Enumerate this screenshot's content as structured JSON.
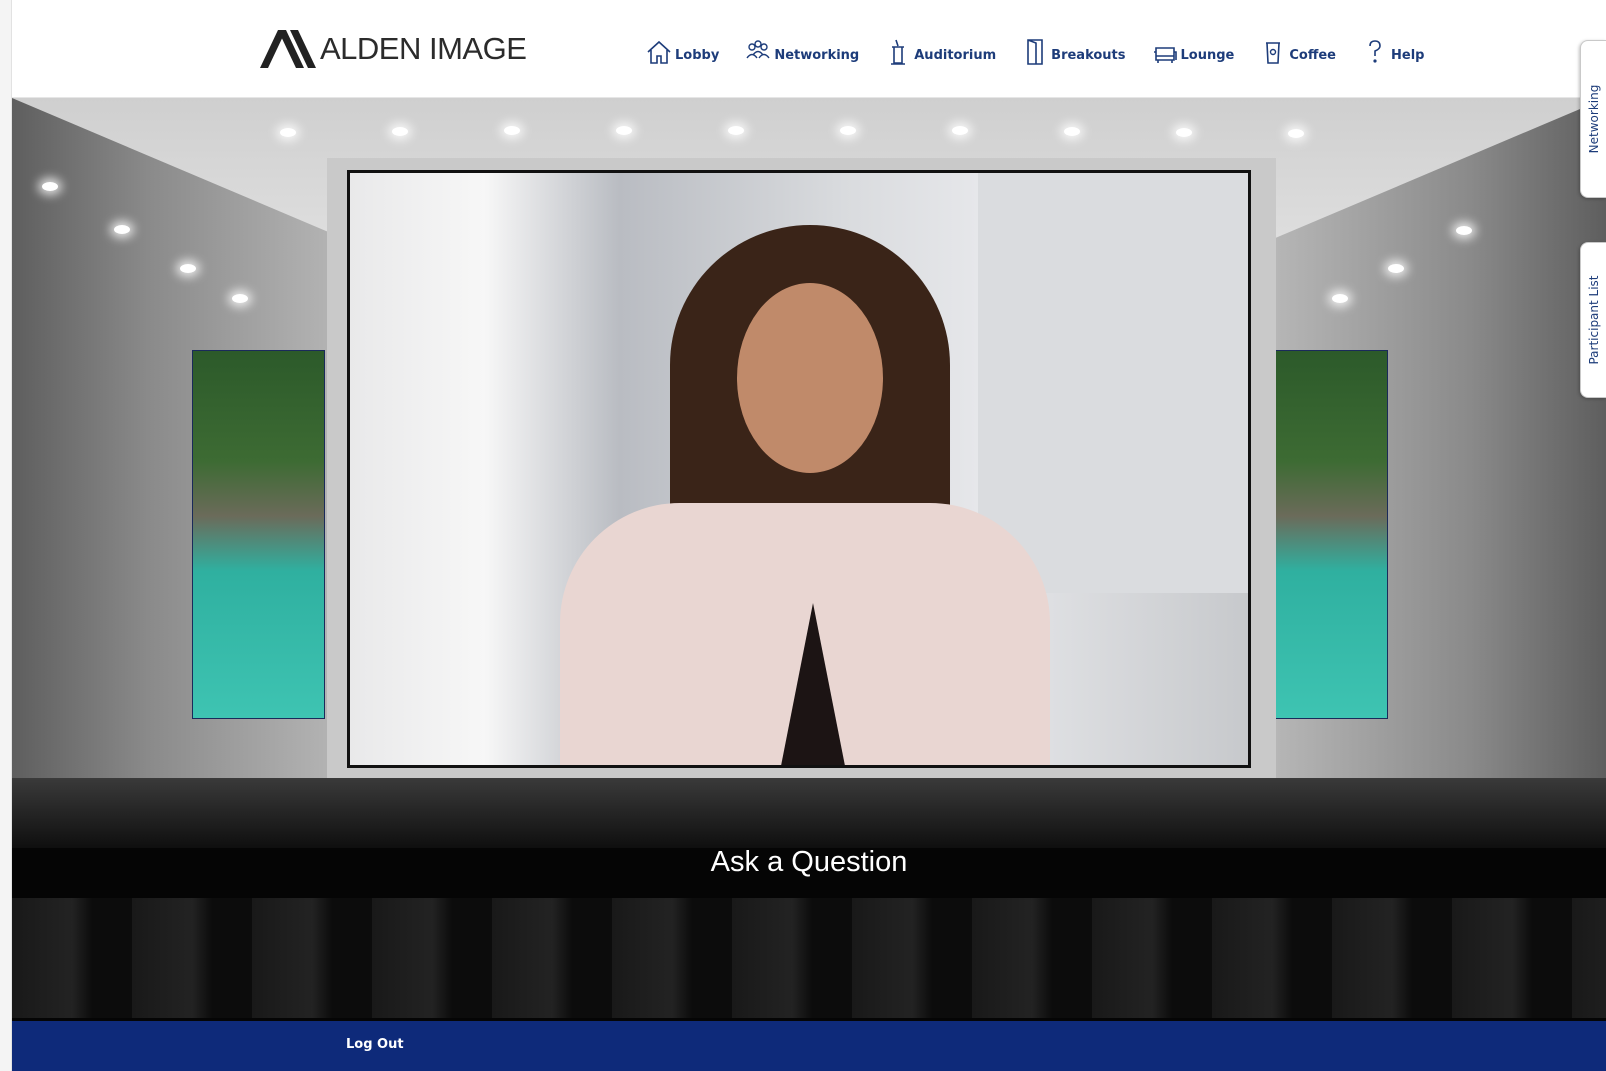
{
  "header": {
    "logo_text": "ALDEN IMAGE",
    "nav": [
      {
        "label": "Lobby",
        "icon": "home-icon"
      },
      {
        "label": "Networking",
        "icon": "people-icon"
      },
      {
        "label": "Auditorium",
        "icon": "podium-icon"
      },
      {
        "label": "Breakouts",
        "icon": "door-icon"
      },
      {
        "label": "Lounge",
        "icon": "sofa-icon"
      },
      {
        "label": "Coffee",
        "icon": "coffee-cup-icon"
      },
      {
        "label": "Help",
        "icon": "question-icon"
      }
    ]
  },
  "side_tabs": {
    "networking": "Networking",
    "participant_list": "Participant List"
  },
  "scene": {
    "ask_question": "Ask a Question"
  },
  "footer": {
    "logout": "Log Out"
  },
  "colors": {
    "brand_navy": "#0e2a7a",
    "nav_text": "#1d3c7a"
  }
}
